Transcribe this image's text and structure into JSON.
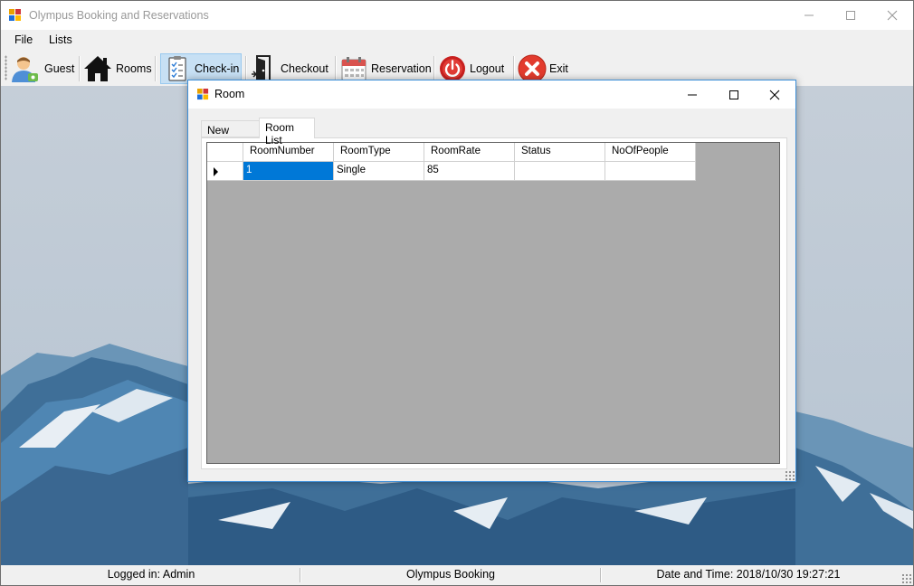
{
  "app": {
    "title": "Olympus Booking and Reservations"
  },
  "menu": {
    "items": [
      "File",
      "Lists"
    ]
  },
  "toolbar": {
    "guest_label": "Guest",
    "rooms_label": "Rooms",
    "checkin_label": "Check-in",
    "checkout_label": "Checkout",
    "reservation_label": "Reservation",
    "logout_label": "Logout",
    "exit_label": "Exit",
    "checked_item": "Check-in"
  },
  "room_window": {
    "title": "Room",
    "tabs": [
      "New Room",
      "Room List"
    ],
    "active_tab": "Room List",
    "grid": {
      "columns": [
        "RoomNumber",
        "RoomType",
        "RoomRate",
        "Status",
        "NoOfPeople"
      ],
      "rows": [
        [
          "1",
          "Single",
          "85",
          "",
          ""
        ]
      ],
      "selected_cell": "RoomNumber"
    }
  },
  "status": {
    "logged_in": "Logged in: Admin",
    "center": "Olympus Booking",
    "datetime": "Date and Time: 2018/10/30 19:27:21"
  },
  "colors": {
    "accent": "#0078d7",
    "grid_bg": "#ababab",
    "window_border": "#3d8fd8"
  },
  "icons": {
    "guest": "user-icon",
    "rooms": "house-icon",
    "checkin": "clipboard-icon",
    "checkout": "door-icon",
    "reservation": "calendar-icon",
    "logout": "power-icon",
    "exit": "close-circle-icon"
  }
}
